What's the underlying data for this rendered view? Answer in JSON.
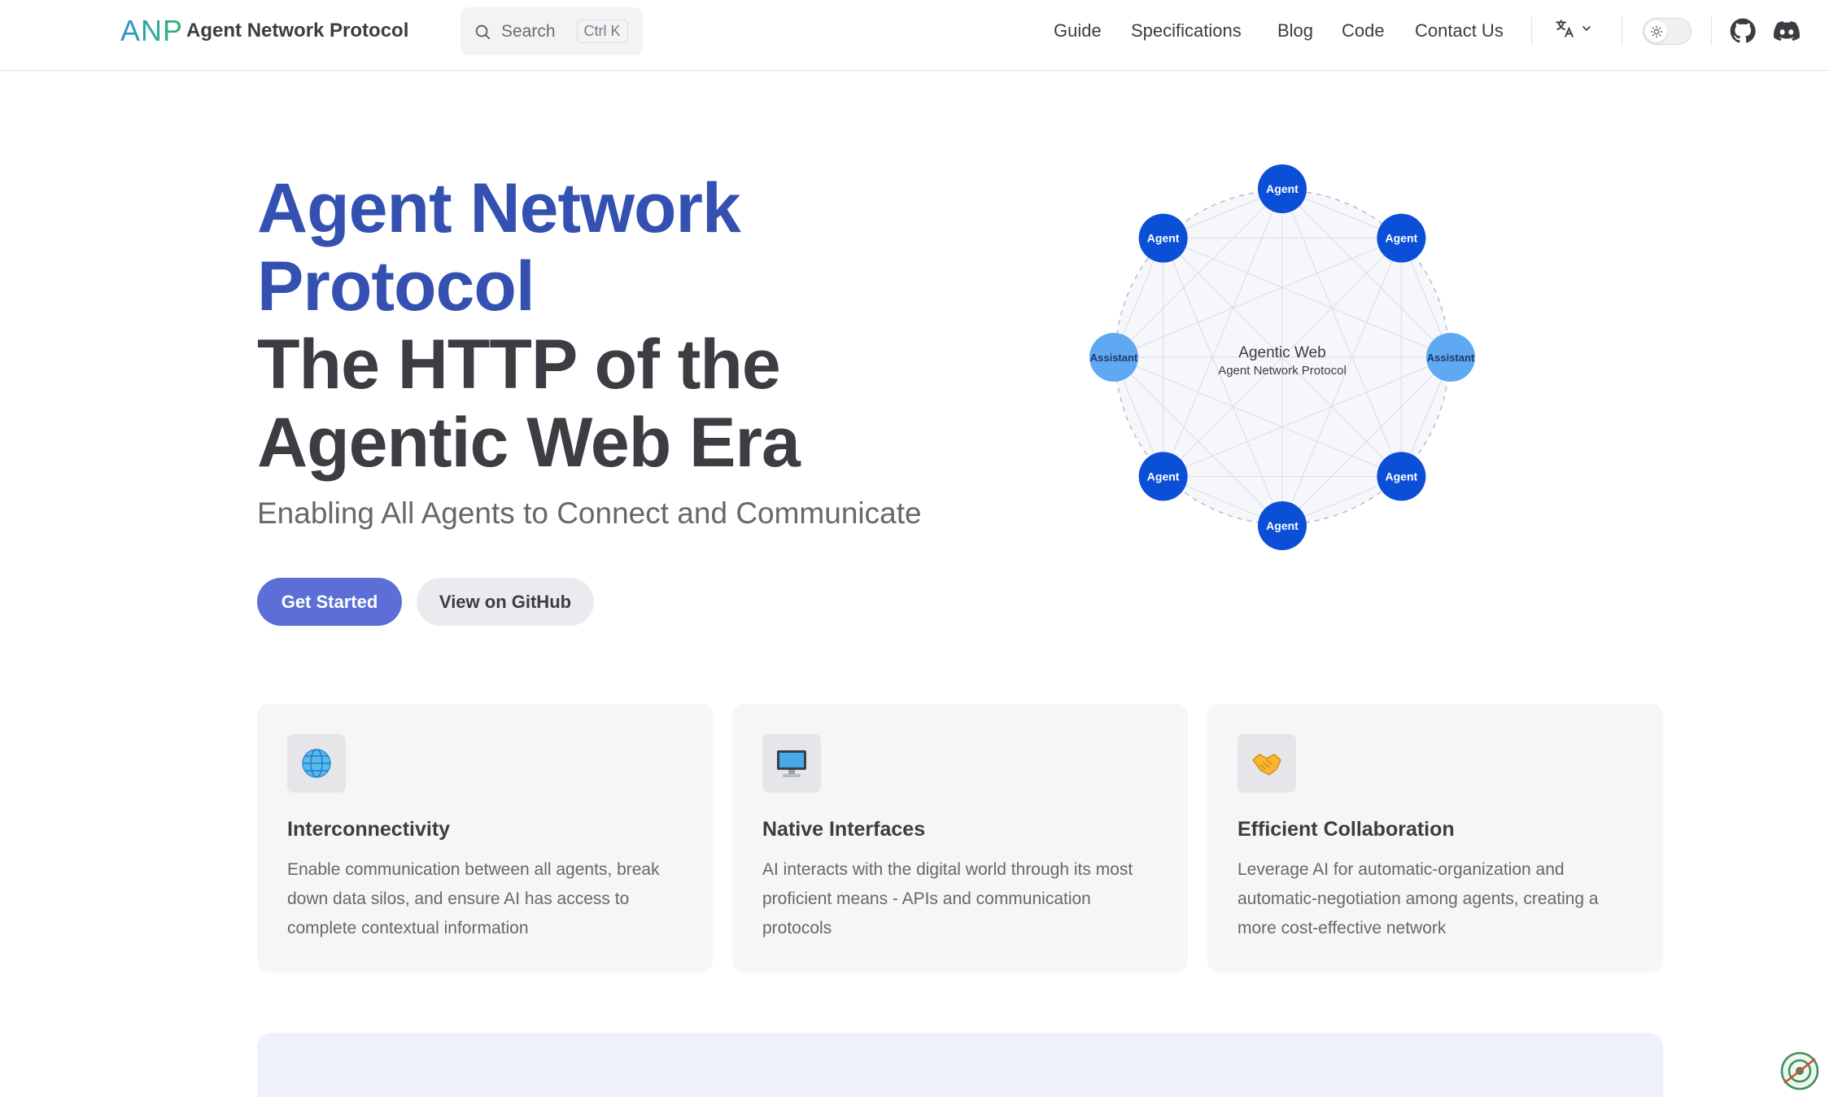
{
  "nav": {
    "logo_text": "ANP",
    "site_title": "Agent Network Protocol",
    "search": {
      "label": "Search",
      "shortcut": "Ctrl K"
    },
    "links": [
      {
        "label": "Guide"
      },
      {
        "label": "Specifications"
      },
      {
        "label": "Blog"
      },
      {
        "label": "Code"
      },
      {
        "label": "Contact Us"
      }
    ],
    "icons": [
      "translate-icon",
      "chevron-down-icon",
      "sun-icon",
      "github-icon",
      "discord-icon"
    ]
  },
  "hero": {
    "name": "Agent Network Protocol",
    "tagline": "The HTTP of the Agentic Web Era",
    "subtitle": "Enabling All Agents to Connect and Communicate",
    "primary_button": "Get Started",
    "secondary_button": "View on GitHub"
  },
  "diagram": {
    "center_title": "Agentic Web",
    "center_subtitle": "Agent Network Protocol",
    "nodes": [
      {
        "label": "Agent",
        "kind": "agent"
      },
      {
        "label": "Agent",
        "kind": "agent"
      },
      {
        "label": "Assistant",
        "kind": "assistant"
      },
      {
        "label": "Agent",
        "kind": "agent"
      },
      {
        "label": "Agent",
        "kind": "agent"
      },
      {
        "label": "Agent",
        "kind": "agent"
      },
      {
        "label": "Assistant",
        "kind": "assistant"
      },
      {
        "label": "Agent",
        "kind": "agent"
      }
    ],
    "colors": {
      "agent": "#0b4fd6",
      "assistant": "#5ea9f2"
    }
  },
  "features": [
    {
      "icon": "globe-icon",
      "glyph": "🌐",
      "title": "Interconnectivity",
      "details": "Enable communication between all agents, break down data silos, and ensure AI has access to complete contextual information"
    },
    {
      "icon": "computer-icon",
      "glyph": "🖥️",
      "title": "Native Interfaces",
      "details": "AI interacts with the digital world through its most proficient means - APIs and communication protocols"
    },
    {
      "icon": "handshake-icon",
      "glyph": "🤝",
      "title": "Efficient Collaboration",
      "details": "Leverage AI for automatic-organization and automatic-negotiation among agents, creating a more cost-effective network"
    }
  ],
  "colors": {
    "brand": "#3451b2",
    "button_primary": "#5b6fd6"
  }
}
